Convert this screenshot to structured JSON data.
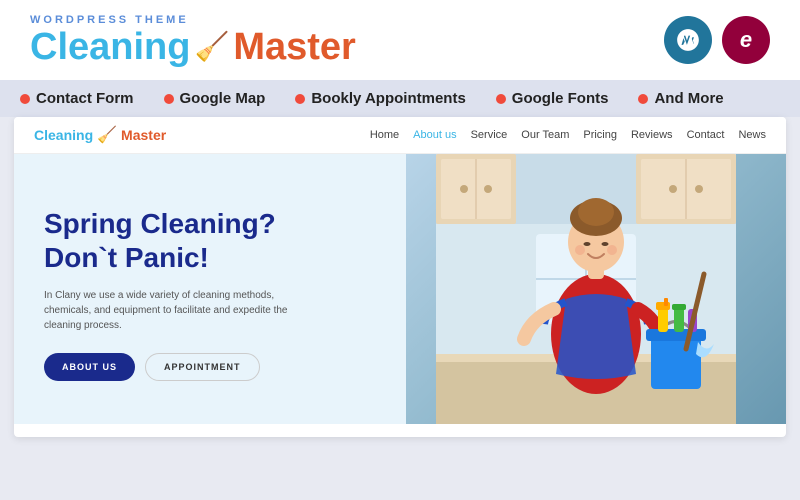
{
  "header": {
    "wordpress_label": "WordPress Theme",
    "logo_cleaning": "Cleaning",
    "logo_master": "Master",
    "logo_icon": "🧹",
    "wp_icon_label": "W",
    "elementor_icon_label": "e"
  },
  "features": [
    {
      "id": "contact-form",
      "label": "Contact Form"
    },
    {
      "id": "google-map",
      "label": "Google Map"
    },
    {
      "id": "bookly-appointments",
      "label": "Bookly Appointments"
    },
    {
      "id": "google-fonts",
      "label": "Google Fonts"
    },
    {
      "id": "and-more",
      "label": "And More"
    }
  ],
  "demo_nav": {
    "logo_cleaning": "Cleaning",
    "logo_master": "Master",
    "logo_icon": "🧹",
    "links": [
      {
        "label": "Home",
        "active": false
      },
      {
        "label": "About us",
        "active": true
      },
      {
        "label": "Service",
        "active": false
      },
      {
        "label": "Our Team",
        "active": false
      },
      {
        "label": "Pricing",
        "active": false
      },
      {
        "label": "Reviews",
        "active": false
      },
      {
        "label": "Contact",
        "active": false
      },
      {
        "label": "News",
        "active": false
      }
    ]
  },
  "hero": {
    "title_line1": "Spring Cleaning?",
    "title_line2": "Don`t Panic!",
    "description": "In Clany we use a wide variety of cleaning methods, chemicals, and equipment to facilitate and expedite the cleaning process.",
    "btn_primary": "ABOUT US",
    "btn_secondary": "APPOINTMENT"
  },
  "colors": {
    "accent_blue": "#3ab5e5",
    "accent_orange": "#e05a2b",
    "nav_blue": "#1a2a8c",
    "wp_bg": "#21759b",
    "elementor_bg": "#92003b",
    "feature_bg": "#dde1ee",
    "dot_color": "#f04a3b"
  }
}
